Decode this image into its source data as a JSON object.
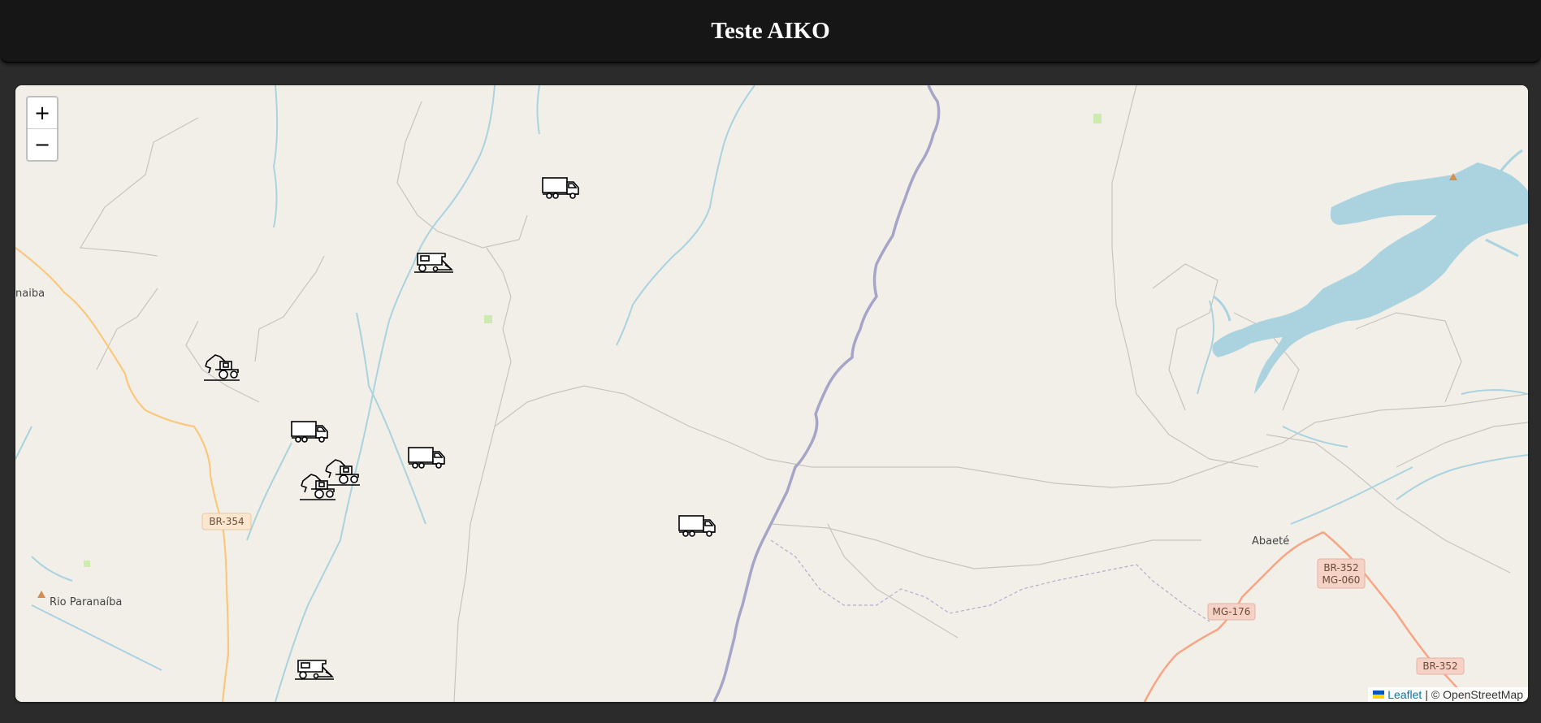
{
  "header": {
    "title": "Teste AIKO"
  },
  "map": {
    "zoom_in_label": "+",
    "zoom_out_label": "−",
    "attribution": {
      "leaflet": "Leaflet",
      "separator": " | © ",
      "osm": "OpenStreetMap"
    },
    "places": {
      "abaete": "Abaeté",
      "rio_paranaiba": "Rio Paranaíba",
      "naiba": "naiba"
    },
    "road_shields": {
      "br354": "BR-354",
      "mg176": "MG-176",
      "br352_line1": "BR-352",
      "br352_line2": "MG-060",
      "br352": "BR-352"
    },
    "markers": [
      {
        "type": "truck-icon"
      },
      {
        "type": "harvester-icon"
      },
      {
        "type": "excavator-icon"
      },
      {
        "type": "truck-icon"
      },
      {
        "type": "truck-icon"
      },
      {
        "type": "excavator-icon"
      },
      {
        "type": "excavator-icon"
      },
      {
        "type": "truck-icon"
      },
      {
        "type": "harvester-icon"
      }
    ],
    "colors": {
      "land": "#f2efe9",
      "water": "#aad3df",
      "river_border": "#a5a5c7",
      "primary_road": "#f7a584",
      "secondary_road": "#fac87d",
      "shield_orange": "#fbe6cf",
      "shield_red": "#f6d2c6"
    }
  }
}
